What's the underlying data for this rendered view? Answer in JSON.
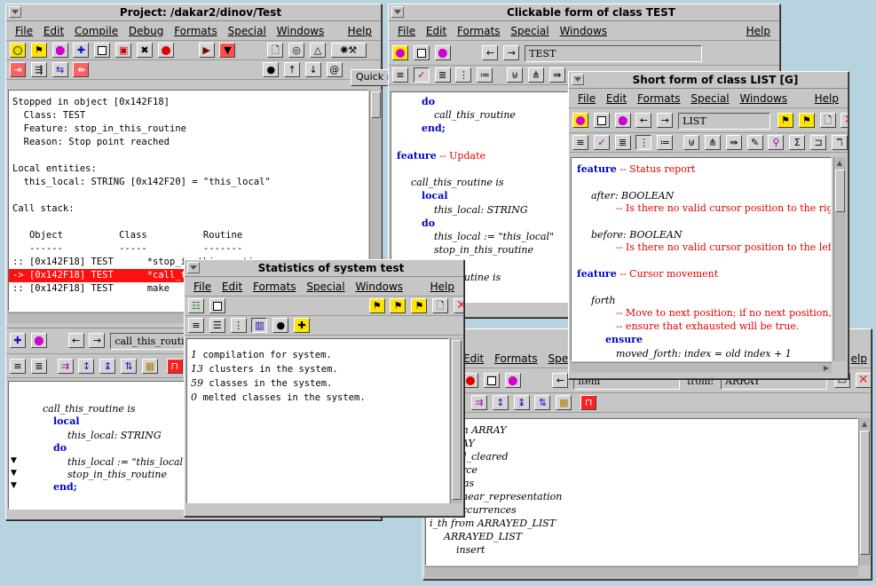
{
  "project": {
    "title": "Project: /dakar2/dinov/Test",
    "menus": [
      "File",
      "Edit",
      "Compile",
      "Debug",
      "Formats",
      "Special",
      "Windows"
    ],
    "help": "Help",
    "tooltip": "Quick melt",
    "output_lines": [
      "Stopped in object [0x142F18]",
      "  Class: TEST",
      "  Feature: stop_in_this_routine",
      "  Reason: Stop point reached",
      "",
      "Local entities:",
      "  this_local: STRING [0x142F20] = \"this_local\"",
      "",
      "Call stack:",
      "",
      "   Object          Class          Routine",
      "   ------          -----          -------",
      ":: [0x142F18] TEST      *stop_in_this_routine",
      "-> [0x142F18] TEST      *call_this_routine",
      ":: [0x142F18] TEST      make"
    ],
    "routine_field": "call_this_routine",
    "routine_lines": [
      "call_this_routine is",
      "local",
      "this_local: STRING",
      "do",
      "this_local := \"this_local\";",
      "stop_in_this_routine",
      "end;"
    ]
  },
  "clickable": {
    "title": "Clickable form of class TEST",
    "menus": [
      "File",
      "Edit",
      "Formats",
      "Special",
      "Windows"
    ],
    "help": "Help",
    "class_field": "TEST",
    "code_lines": [
      "do",
      "call_this_routine",
      "end;",
      "",
      "feature -- Update",
      "",
      "call_this_routine is",
      "local",
      "this_local: STRING",
      "do",
      "this_local := \"this_local\"",
      "stop_in_this_routine",
      "",
      "routine is"
    ]
  },
  "short_form": {
    "title": "Short form of class LIST [G]",
    "menus": [
      "File",
      "Edit",
      "Formats",
      "Special",
      "Windows"
    ],
    "help": "Help",
    "class_field": "LIST",
    "lines": [
      {
        "k": "feature",
        "c": "-- Status report"
      },
      {
        "t": "after: BOOLEAN"
      },
      {
        "c": "-- Is there no valid cursor position to the right of"
      },
      {
        "t": "before: BOOLEAN"
      },
      {
        "c": "-- Is there no valid cursor position to the left of c"
      },
      {
        "k": "feature",
        "c": "-- Cursor movement"
      },
      {
        "t": "forth"
      },
      {
        "c": "-- Move to next position; if no next position,"
      },
      {
        "c": "-- ensure that exhausted will be true."
      },
      {
        "k": "ensure"
      },
      {
        "t": "moved_forth: index = old index + 1"
      }
    ]
  },
  "statistics": {
    "title": "Statistics of system test",
    "menus": [
      "File",
      "Edit",
      "Formats",
      "Special",
      "Windows"
    ],
    "help": "Help",
    "lines": [
      {
        "n": "1",
        "t": " compilation for system."
      },
      {
        "n": "13",
        "t": " clusters in the system."
      },
      {
        "n": "59",
        "t": " classes in the system."
      },
      {
        "n": "0",
        "t": " melted classes in the system."
      }
    ]
  },
  "feature_tool": {
    "menus_visible": [
      "Edit",
      "Formats",
      "Speci"
    ],
    "help_partial": "elp",
    "feature_field": "item",
    "from_label": "from:",
    "from_field": "ARRAY",
    "lines": [
      "on ARRAY",
      "AY",
      "l_cleared",
      "rce",
      "as",
      "near_representation",
      "ccurrences",
      "i_th from ARRAYED_LIST",
      "ARRAYED_LIST",
      "insert"
    ]
  }
}
